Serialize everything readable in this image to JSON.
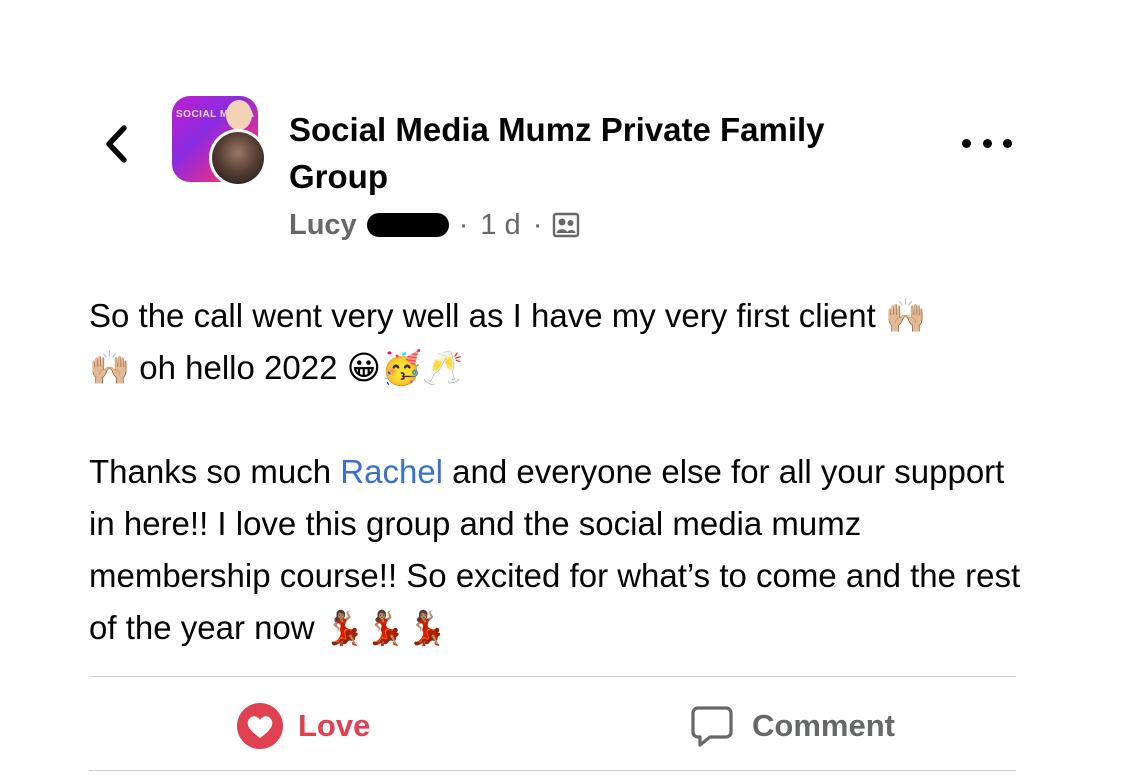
{
  "header": {
    "group_name": "Social Media Mumz Private Family Group",
    "group_avatar_text": "SOCIAL MEDIA",
    "author_name": "Lucy",
    "time": "1 d",
    "separator": "·",
    "audience_icon": "group-members-icon"
  },
  "post": {
    "line1": "So the call went very well as I have my very first client 🙌🏼",
    "line2": "🙌🏼 oh hello 2022 😀🥳🥂",
    "thanks_before": "Thanks so much ",
    "mention": "Rachel",
    "thanks_after": " and everyone else for all your support in here!! I love this group and the social media mumz membership course!! So excited for what’s to come and the rest of the year now 💃🏽💃🏽💃🏽"
  },
  "actions": {
    "love_label": "Love",
    "comment_label": "Comment",
    "love_color": "#e0404f",
    "comment_color": "#65676b"
  },
  "colors": {
    "mention": "#3b6fd1",
    "meta_text": "#65676b"
  }
}
